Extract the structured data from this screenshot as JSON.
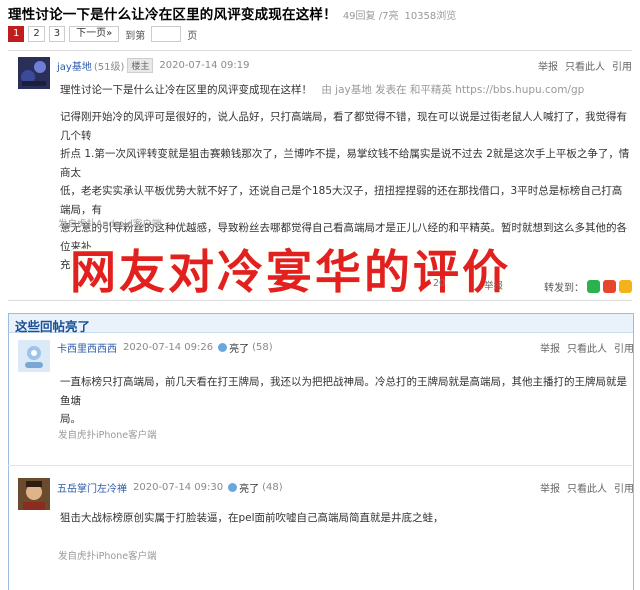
{
  "thread": {
    "title": "理性讨论一下是什么让冷在区里的风评变成现在这样！",
    "replies": "49回复 /7亮",
    "views": "10358浏览"
  },
  "pager": {
    "pages": [
      "1",
      "2",
      "3"
    ],
    "next": "下一页»",
    "goto": "到第",
    "page_suffix": "页"
  },
  "main_post": {
    "user": "jay基地",
    "user_count": "(51级)",
    "badge": "楼主",
    "time": "2020-07-14 09:19",
    "actions": [
      "举报",
      "只看此人",
      "引用"
    ],
    "quote_text": "理性讨论一下是什么让冷在区里的风评变成现在这样！",
    "quote_src": "由 jay基地 发表在 和平精英 https://bbs.hupu.com/gp",
    "body_lines": [
      "记得刚开始冷的风评可是很好的，说人品好，只打高端局，看了都觉得不错，现在可以说是过街老鼠人人喊打了，我觉得有几个转",
      "折点 1.第一次风评转变就是狙击赛赖钱那次了，兰博咋不提，易掌纹钱不给属实是说不过去 2就是这次手上平板之争了，情商太",
      "低，老老实实承认平板优势大就不好了，还说自己是个185大汉子，扭扭捏捏弱的还在那找借口，3平时总是标榜自己打高端局，有",
      "意无意的引导粉丝的这种优越感，导致粉丝去哪都觉得自己看高端局才是正儿八经的和平精英。暂时就想到这么多其他的各位来补",
      "充吧"
    ],
    "client": "发自虎扑Android客户端",
    "partial_date": "20",
    "partial_report": "举报",
    "share_label": "转发到："
  },
  "overlay": {
    "text": "网友对冷宴华的评价"
  },
  "highlight": {
    "title": "这些回帖亮了",
    "replies": [
      {
        "user": "卡西里西西西",
        "time": "2020-07-14 09:26",
        "light_label": "亮了",
        "light_count": "(58)",
        "actions": [
          "举报",
          "只看此人",
          "引用"
        ],
        "body": [
          "一直标榜只打高端局，前几天看在打王牌局，我还以为把把战神局。冷总打的王牌局就是高端局，其他主播打的王牌局就是鱼塘",
          "局。"
        ],
        "client": "发自虎扑iPhone客户端"
      },
      {
        "user": "五岳掌门左冷禅",
        "time": "2020-07-14 09:30",
        "light_label": "亮了",
        "light_count": "(48)",
        "actions": [
          "举报",
          "只看此人",
          "引用"
        ],
        "body": [
          "狙击大战标榜原创实属于打脸装逼，在pel面前吹嘘自己高端局简直就是井底之蛙，"
        ],
        "client": "发自虎扑iPhone客户端"
      }
    ]
  },
  "colors": {
    "brand_red": "#c01e1e",
    "link_blue": "#2b5aa8",
    "overlay_red": "#e2201d",
    "highlight_border": "#9dbde0"
  }
}
